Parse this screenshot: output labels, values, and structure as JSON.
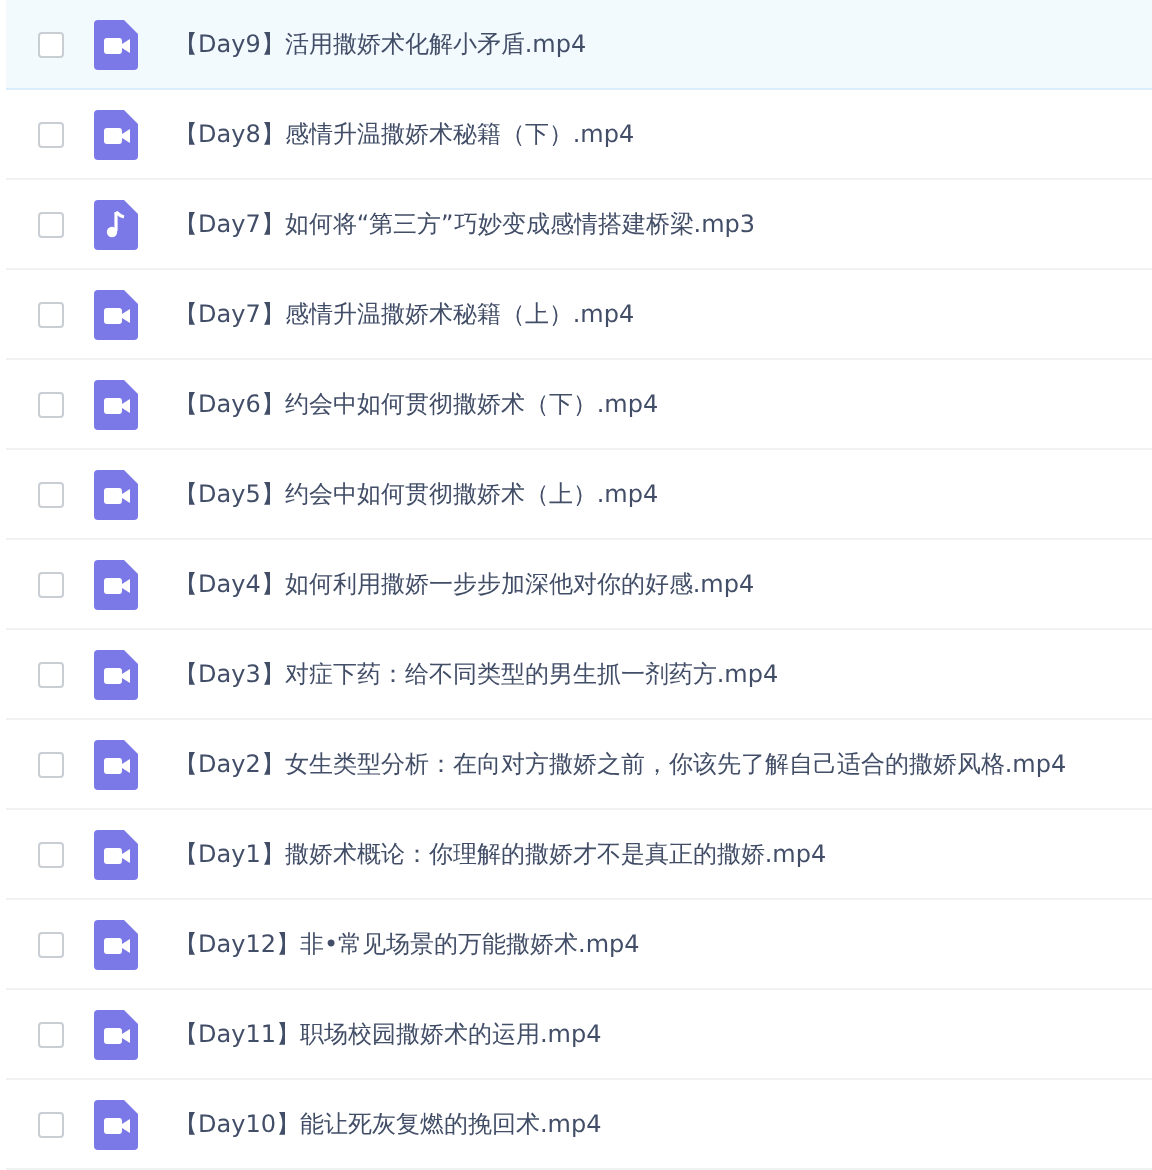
{
  "files": [
    {
      "name": "【Day9】活用撒娇术化解小矛盾.mp4",
      "kind": "video",
      "checked": false,
      "highlighted": true
    },
    {
      "name": "【Day8】感情升温撒娇术秘籍（下）.mp4",
      "kind": "video",
      "checked": false,
      "highlighted": false
    },
    {
      "name": "【Day7】如何将“第三方”巧妙变成感情搭建桥梁.mp3",
      "kind": "audio",
      "checked": false,
      "highlighted": false
    },
    {
      "name": "【Day7】感情升温撒娇术秘籍（上）.mp4",
      "kind": "video",
      "checked": false,
      "highlighted": false
    },
    {
      "name": "【Day6】约会中如何贯彻撒娇术（下）.mp4",
      "kind": "video",
      "checked": false,
      "highlighted": false
    },
    {
      "name": "【Day5】约会中如何贯彻撒娇术（上）.mp4",
      "kind": "video",
      "checked": false,
      "highlighted": false
    },
    {
      "name": "【Day4】如何利用撒娇一步步加深他对你的好感.mp4",
      "kind": "video",
      "checked": false,
      "highlighted": false
    },
    {
      "name": "【Day3】对症下药：给不同类型的男生抓一剂药方.mp4",
      "kind": "video",
      "checked": false,
      "highlighted": false
    },
    {
      "name": "【Day2】女生类型分析：在向对方撒娇之前，你该先了解自己适合的撒娇风格.mp4",
      "kind": "video",
      "checked": false,
      "highlighted": false
    },
    {
      "name": "【Day1】撒娇术概论：你理解的撒娇才不是真正的撒娇.mp4",
      "kind": "video",
      "checked": false,
      "highlighted": false
    },
    {
      "name": "【Day12】非•常见场景的万能撒娇术.mp4",
      "kind": "video",
      "checked": false,
      "highlighted": false
    },
    {
      "name": "【Day11】职场校园撒娇术的运用.mp4",
      "kind": "video",
      "checked": false,
      "highlighted": false
    },
    {
      "name": "【Day10】能让死灰复燃的挽回术.mp4",
      "kind": "video",
      "checked": false,
      "highlighted": false
    }
  ]
}
